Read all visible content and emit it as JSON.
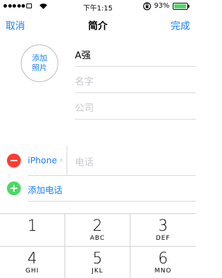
{
  "status_bar": {
    "time": "下午1:15",
    "battery_percent": "93%",
    "battery_level": 0.93,
    "battery_color": "#4cd964"
  },
  "nav": {
    "cancel": "取消",
    "title": "简介",
    "done": "完成"
  },
  "photo": {
    "add_label": "添加\n照片"
  },
  "fields": {
    "name": "A强",
    "first_name_placeholder": "名字",
    "company_placeholder": "公司"
  },
  "phone": {
    "label": "iPhone",
    "placeholder": "电话",
    "add_label": "添加电话"
  },
  "keyboard": {
    "keys": [
      {
        "num": "1",
        "letters": ""
      },
      {
        "num": "2",
        "letters": "ABC"
      },
      {
        "num": "3",
        "letters": "DEF"
      },
      {
        "num": "4",
        "letters": "GHI"
      },
      {
        "num": "5",
        "letters": "JKL"
      },
      {
        "num": "6",
        "letters": "MNO"
      }
    ]
  },
  "colors": {
    "accent": "#157efb",
    "delete": "#ff3b30",
    "add": "#4cd964"
  },
  "icons": {
    "signal": "signal-dots-icon",
    "wifi": "wifi-icon",
    "lock": "orientation-lock-icon",
    "battery": "battery-icon",
    "chevron": "chevron-right-icon"
  }
}
